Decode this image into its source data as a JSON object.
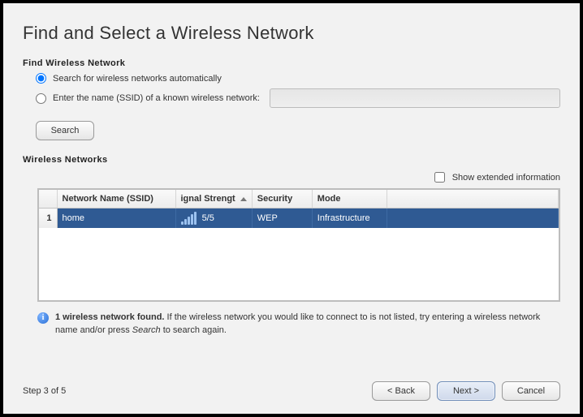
{
  "title": "Find and Select a Wireless Network",
  "find": {
    "heading": "Find Wireless Network",
    "radio_auto": "Search for wireless networks automatically",
    "radio_manual": "Enter the name (SSID) of a known wireless network:",
    "ssid_value": "",
    "search_label": "Search"
  },
  "list": {
    "heading": "Wireless Networks",
    "show_extended": "Show extended information",
    "columns": {
      "ssid": "Network Name (SSID)",
      "signal": "ignal Strengt",
      "security": "Security",
      "mode": "Mode"
    },
    "rows": [
      {
        "idx": "1",
        "ssid": "home",
        "signal": "5/5",
        "security": "WEP",
        "mode": "Infrastructure"
      }
    ]
  },
  "info": {
    "bold": "1 wireless network found.",
    "rest": " If the wireless network you would like to connect to is not listed, try entering a wireless network name and/or press ",
    "italic": "Search",
    "tail": " to search again."
  },
  "footer": {
    "step": "Step 3 of 5",
    "back": "< Back",
    "next": "Next >",
    "cancel": "Cancel"
  }
}
